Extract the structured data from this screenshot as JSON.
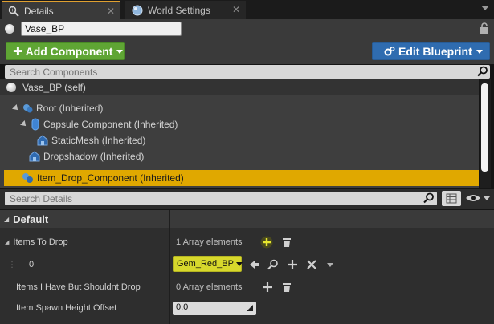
{
  "tabs": [
    {
      "label": "Details",
      "active": true
    },
    {
      "label": "World Settings",
      "active": false
    }
  ],
  "name_field": {
    "value": "Vase_BP"
  },
  "toolbar": {
    "add_component_label": "Add Component",
    "edit_blueprint_label": "Edit Blueprint"
  },
  "component_search": {
    "placeholder": "Search Components"
  },
  "components": {
    "self": "Vase_BP (self)",
    "items": [
      {
        "label": "Root (Inherited)"
      },
      {
        "label": "Capsule Component (Inherited)"
      },
      {
        "label": "StaticMesh (Inherited)"
      },
      {
        "label": "Dropshadow (Inherited)"
      },
      {
        "label": "Item_Drop_Component (Inherited)"
      }
    ]
  },
  "details_search": {
    "placeholder": "Search Details"
  },
  "category": {
    "label": "Default"
  },
  "properties": {
    "items_to_drop": {
      "label": "Items To Drop",
      "value": "1 Array elements"
    },
    "element_0": {
      "index": "0",
      "value": "Gem_Red_BP"
    },
    "items_have": {
      "label": "Items I Have But Shouldnt Drop",
      "value": "0 Array elements"
    },
    "spawn_height": {
      "label": "Item Spawn Height Offset",
      "value": "0,0"
    }
  },
  "colors": {
    "add_button": "#5fa534",
    "edit_button": "#2f6cb0",
    "selected_row": "#e0a800",
    "asset_button": "#d7d82c",
    "tab_accent": "#e0a030"
  }
}
